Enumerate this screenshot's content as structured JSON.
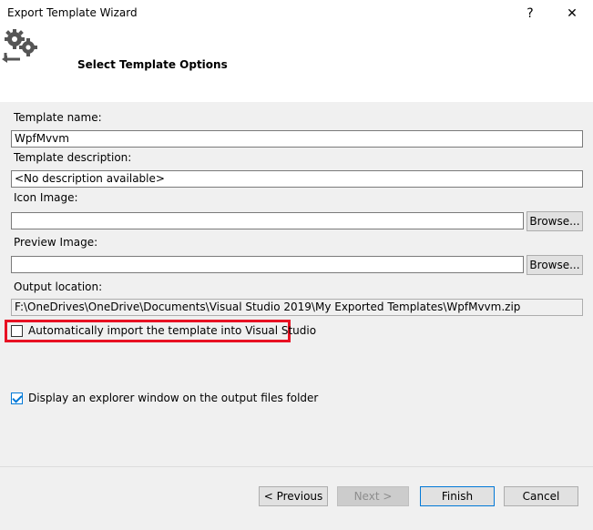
{
  "window": {
    "title": "Export Template Wizard",
    "help_label": "?",
    "close_label": "✕"
  },
  "header": {
    "title": "Select Template Options",
    "icon": "gears-export-icon"
  },
  "form": {
    "template_name_label": "Template name:",
    "template_name_value": "WpfMvvm",
    "template_description_label": "Template description:",
    "template_description_value": "<No description available>",
    "icon_image_label": "Icon Image:",
    "icon_image_value": "",
    "icon_browse_label": "Browse...",
    "preview_image_label": "Preview Image:",
    "preview_image_value": "",
    "preview_browse_label": "Browse...",
    "output_location_label": "Output location:",
    "output_location_value": "F:\\OneDrives\\OneDrive\\Documents\\Visual Studio 2019\\My Exported Templates\\WpfMvvm.zip",
    "auto_import": {
      "label": "Automatically import the template into Visual Studio",
      "checked": false
    },
    "explorer_window": {
      "label": "Display an explorer window on the output files folder",
      "checked": true
    }
  },
  "footer": {
    "previous": "< Previous",
    "next": "Next >",
    "finish": "Finish",
    "cancel": "Cancel"
  },
  "colors": {
    "highlight": "#e81123",
    "accent": "#0078d7"
  }
}
